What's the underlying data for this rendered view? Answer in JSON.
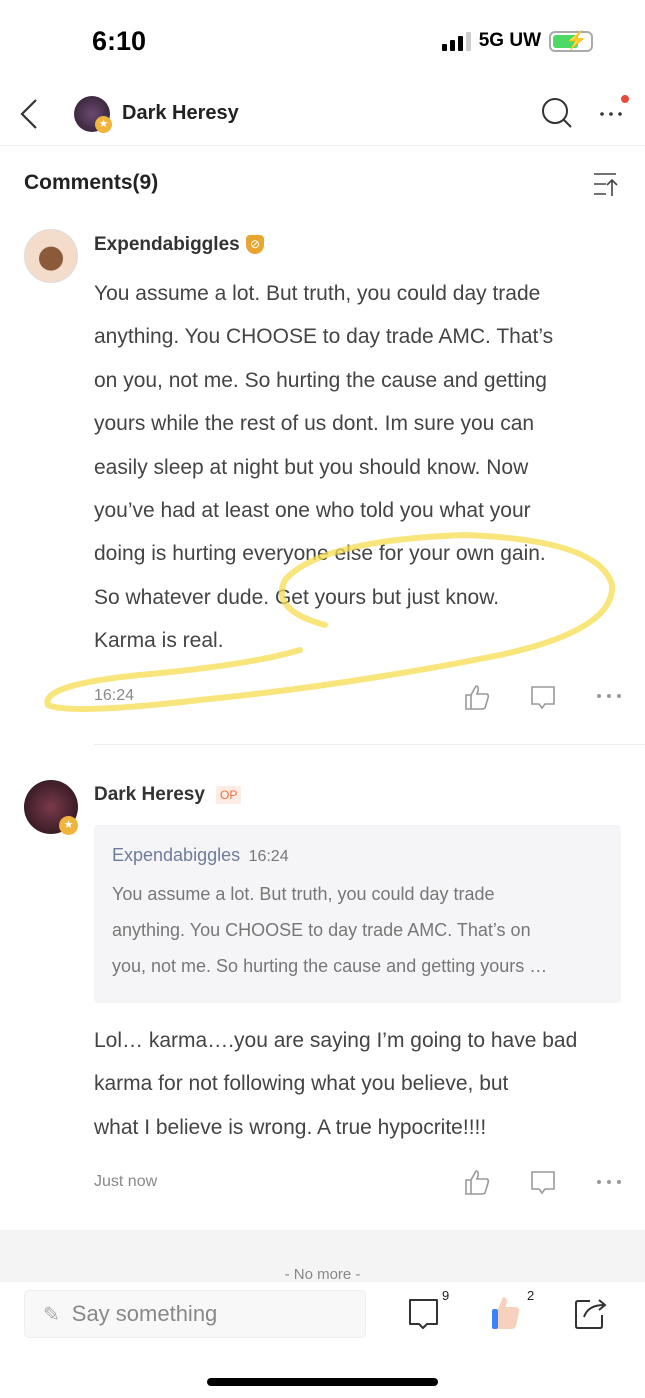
{
  "status_bar": {
    "time": "6:10",
    "network": "5G UW"
  },
  "nav": {
    "title": "Dark Heresy",
    "icons": [
      "back-icon",
      "search-icon",
      "more-icon"
    ]
  },
  "comments": {
    "header": "Comments(9)"
  },
  "comment1": {
    "author": "Expendabiggles",
    "lines": [
      "You assume a lot.  But truth, you could day trade",
      "anything. You CHOOSE to day trade AMC.   That’s",
      "on you, not me. So hurting the cause and getting",
      "yours while the rest of us dont.  Im sure you can",
      "easily sleep at night but you should know. Now",
      "you’ve had at least one who told you what your",
      "doing is hurting everyone else for your own gain.",
      "So whatever dude. Get yours but just know.",
      "Karma is real."
    ],
    "time": "16:24"
  },
  "comment2": {
    "author": "Dark Heresy",
    "badge": "OP",
    "quote": {
      "author": "Expendabiggles",
      "time": "16:24",
      "lines": [
        "You assume a lot.  But truth, you could day trade",
        "anything. You CHOOSE to day trade AMC.   That’s on",
        "you, not me. So hurting the cause and getting yours …"
      ]
    },
    "lines": [
      "Lol… karma….you are saying I’m going to have bad",
      "karma for not following what you believe, but",
      "what I believe is wrong. A true hypocrite!!!!"
    ],
    "time": "Just now"
  },
  "footer": {
    "no_more": "- No more -",
    "placeholder": "Say something",
    "comment_count": "9",
    "like_count": "2"
  },
  "colors": {
    "highlight": "#f5dc50",
    "badge": "#e8a530",
    "op": "#f07040",
    "like_blue": "#3b82f6"
  }
}
